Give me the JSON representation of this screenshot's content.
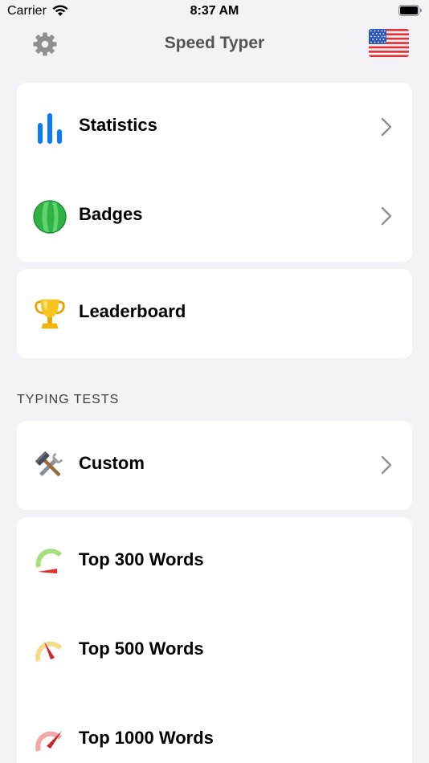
{
  "status_bar": {
    "carrier": "Carrier",
    "time": "8:37 AM"
  },
  "nav": {
    "title": "Speed Typer",
    "settings_icon": "gear-icon",
    "language_icon": "us-flag-icon"
  },
  "menu_group_1": {
    "items": [
      {
        "label": "Statistics",
        "icon": "bar-chart-icon",
        "has_chevron": true
      },
      {
        "label": "Badges",
        "icon": "badge-icon",
        "has_chevron": true
      }
    ]
  },
  "menu_group_2": {
    "items": [
      {
        "label": "Leaderboard",
        "icon": "trophy-icon",
        "has_chevron": false
      }
    ]
  },
  "typing_tests": {
    "header": "TYPING TESTS",
    "custom": {
      "label": "Custom",
      "icon": "tools-icon",
      "has_chevron": true
    },
    "presets": [
      {
        "label": "Top 300 Words",
        "icon": "speedometer-slow-icon"
      },
      {
        "label": "Top 500 Words",
        "icon": "speedometer-medium-icon"
      },
      {
        "label": "Top 1000 Words",
        "icon": "speedometer-fast-icon"
      }
    ]
  },
  "colors": {
    "accent_blue": "#0a7aff",
    "badge_green": "#34c759",
    "background": "#f2f2f7",
    "card": "#ffffff",
    "chevron": "#8e8e93"
  }
}
